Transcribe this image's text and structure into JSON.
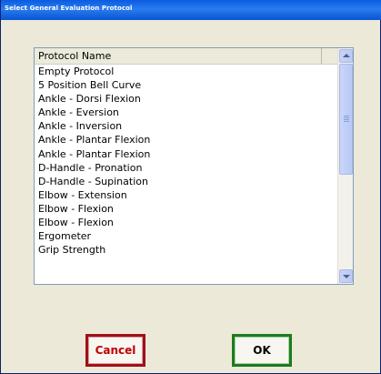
{
  "window": {
    "title": "Select General Evaluation Protocol"
  },
  "list": {
    "column_header": "Protocol Name",
    "items": [
      "Empty Protocol",
      "5 Position Bell Curve",
      "Ankle - Dorsi Flexion",
      "Ankle - Eversion",
      "Ankle - Inversion",
      "Ankle - Plantar Flexion",
      "Ankle - Plantar Flexion",
      "D-Handle - Pronation",
      "D-Handle - Supination",
      "Elbow - Extension",
      "Elbow - Flexion",
      "Elbow - Flexion",
      "Ergometer",
      "Grip Strength"
    ]
  },
  "buttons": {
    "cancel": "Cancel",
    "ok": "OK"
  }
}
